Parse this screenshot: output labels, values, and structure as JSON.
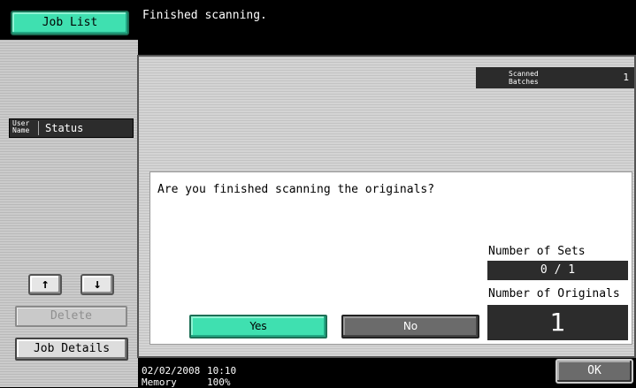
{
  "sidebar": {
    "job_list_label": "Job List",
    "columns": {
      "user_name": "User Name",
      "status": "Status"
    },
    "up_arrow": "↑",
    "down_arrow": "↓",
    "delete_label": "Delete",
    "job_details_label": "Job Details"
  },
  "message": "Finished scanning.",
  "scanned_batches": {
    "label": "Scanned Batches",
    "value": "1"
  },
  "dialog": {
    "question": "Are you finished scanning the originals?",
    "yes_label": "Yes",
    "no_label": "No",
    "sets_label": "Number of Sets",
    "sets_value": "0 / 1",
    "originals_label": "Number of Originals",
    "originals_value": "1"
  },
  "status_bar": {
    "date": "02/02/2008",
    "time": "10:10",
    "memory_label": "Memory",
    "memory_value": "100%"
  },
  "ok_label": "OK",
  "colors": {
    "accent_green": "#3fe0b0",
    "dark_panel": "#2c2c2c",
    "background": "#000000"
  }
}
